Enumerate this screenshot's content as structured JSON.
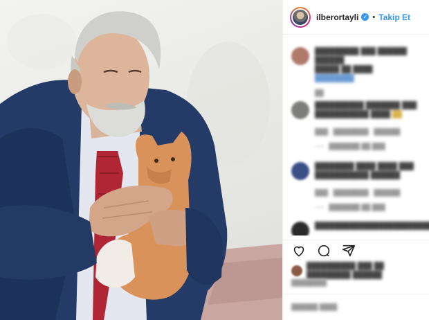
{
  "header": {
    "username": "ilberortayli",
    "verified_icon": "verified-badge-icon",
    "separator": "•",
    "follow_label": "Takip Et",
    "accent_color": "#3897f0"
  },
  "icons": {
    "like": "heart-icon",
    "comment": "comment-bubble-icon",
    "share": "share-arrow-icon"
  }
}
